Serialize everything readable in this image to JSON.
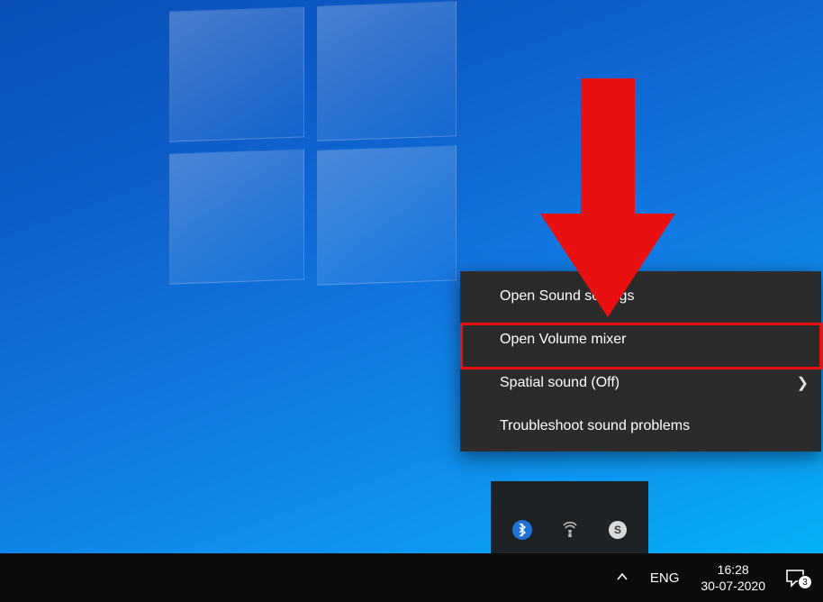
{
  "context_menu": {
    "items": [
      {
        "label": "Open Sound settings",
        "has_submenu": false
      },
      {
        "label": "Open Volume mixer",
        "has_submenu": false
      },
      {
        "label": "Spatial sound (Off)",
        "has_submenu": true
      },
      {
        "label": "Troubleshoot sound problems",
        "has_submenu": false
      }
    ],
    "highlighted_index": 1
  },
  "taskbar": {
    "language": "ENG",
    "clock_time": "16:28",
    "clock_date": "30-07-2020",
    "notifications_count": "3"
  },
  "tray_icons": {
    "bluetooth": "bluetooth-icon",
    "hotspot": "hotspot-icon",
    "skype": "skype-icon"
  }
}
